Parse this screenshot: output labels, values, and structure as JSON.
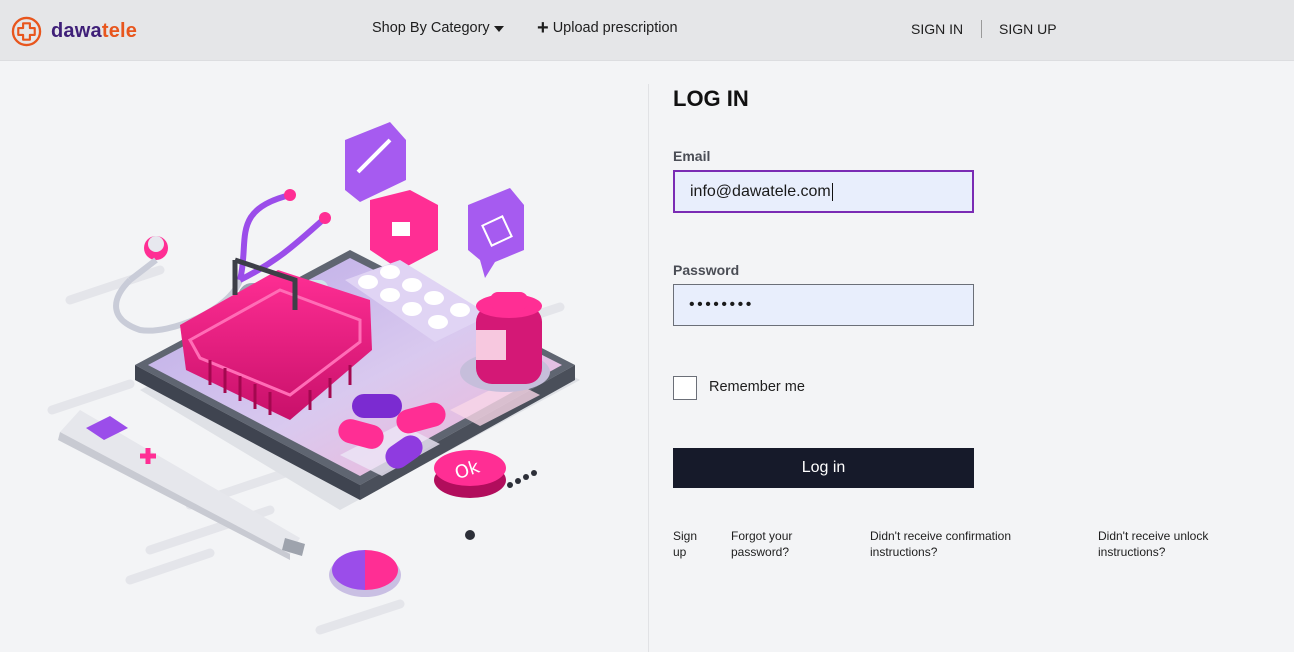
{
  "header": {
    "logo_part1": "dawa",
    "logo_part2": "tele",
    "nav_category": "Shop By Category",
    "nav_upload": "Upload prescription",
    "nav_signin": "SIGN IN",
    "nav_signup": "SIGN UP"
  },
  "form": {
    "title": "LOG IN",
    "email_label": "Email",
    "email_value": "info@dawatele.com",
    "password_label": "Password",
    "password_value": "••••••••",
    "remember_label": "Remember me",
    "login_button": "Log in"
  },
  "links": {
    "sign_up": "Sign up",
    "forgot": "Forgot your password?",
    "confirmation": "Didn't receive confirmation instructions?",
    "unlock": "Didn't receive unlock instructions?"
  },
  "colors": {
    "brand_purple": "#3f1f78",
    "brand_orange": "#e8561d",
    "button_dark": "#161a2a",
    "focus_border": "#7a2bb4",
    "field_bg": "#e8eefc"
  },
  "icons": {
    "logo": "plus-circle-icon",
    "category_caret": "caret-down-icon",
    "upload": "plus-icon"
  }
}
